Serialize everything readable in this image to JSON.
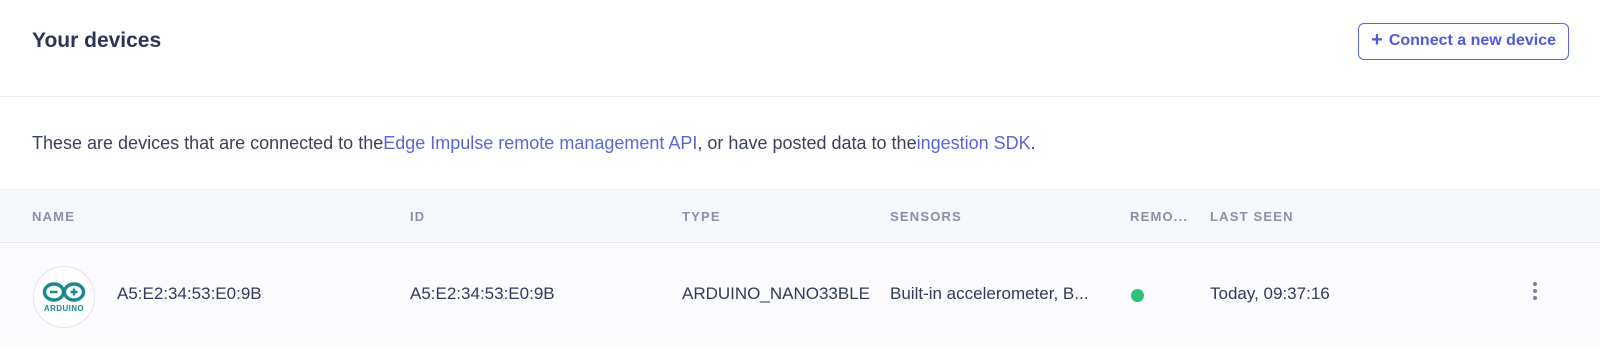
{
  "header": {
    "title": "Your devices",
    "connect_button": "Connect a new device",
    "connect_icon": "plus-icon"
  },
  "intro": {
    "text_before": "These are devices that are connected to the ",
    "link1": "Edge Impulse remote management API",
    "text_middle": ", or have posted data to the ",
    "link2": "ingestion SDK",
    "text_after": "."
  },
  "table": {
    "columns": [
      "NAME",
      "ID",
      "TYPE",
      "SENSORS",
      "REMO...",
      "LAST SEEN"
    ],
    "rows": [
      {
        "logo_text": "ARDUINO",
        "name": "A5:E2:34:53:E0:9B",
        "id": "A5:E2:34:53:E0:9B",
        "type": "ARDUINO_NANO33BLE",
        "sensors": "Built-in accelerometer, B...",
        "remote_status_color": "#2ec27e",
        "last_seen": "Today, 09:37:16"
      }
    ]
  },
  "colors": {
    "accent": "#5a67d8",
    "status_online": "#2ec27e",
    "arduino_teal": "#1a8a8f"
  }
}
